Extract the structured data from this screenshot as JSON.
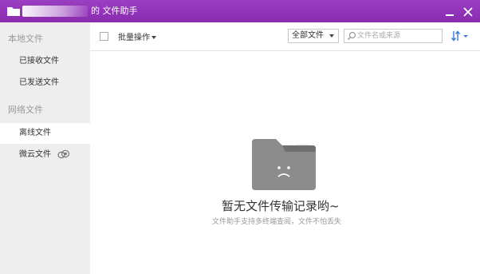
{
  "titlebar": {
    "title": "的 文件助手",
    "accent_color": "#8d2fb3",
    "icons": {
      "folder": "folder-icon",
      "minimize": "minimize-icon",
      "close": "close-icon"
    }
  },
  "sidebar": {
    "local_group": "本地文件",
    "local_items": [
      "已接收文件",
      "已发送文件"
    ],
    "network_group": "网络文件",
    "network_items": [
      "离线文件",
      "微云文件"
    ],
    "active_item": "离线文件",
    "weiyun_icon": "cloud-icon"
  },
  "toolbar": {
    "batch_label": "批量操作",
    "filter_value": "全部文件",
    "search_placeholder": "文件名或来源",
    "icons": {
      "search": "search-icon",
      "sort": "sort-icon"
    }
  },
  "empty": {
    "title": "暂无文件传输记录哟~",
    "subtitle": "文件助手支持多终端查阅，文件不怕丢失",
    "icon": "sad-folder-icon"
  }
}
